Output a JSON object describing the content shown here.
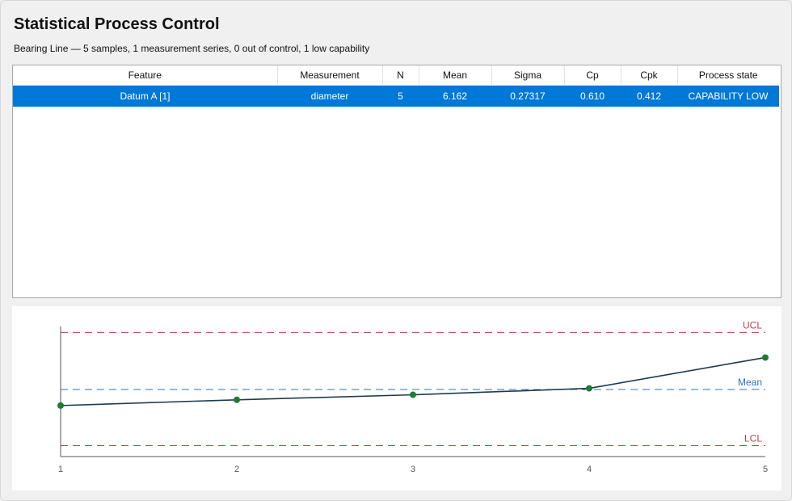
{
  "header": {
    "title": "Statistical Process Control",
    "subtitle": "Bearing Line — 5 samples, 1 measurement series, 0 out of control, 1 low capability"
  },
  "table": {
    "columns": [
      "Feature",
      "Measurement",
      "N",
      "Mean",
      "Sigma",
      "Cp",
      "Cpk",
      "Process state"
    ],
    "rows": [
      {
        "feature": "Datum A [1]",
        "measurement": "diameter",
        "n": "5",
        "mean": "6.162",
        "sigma": "0.27317",
        "cp": "0.610",
        "cpk": "0.412",
        "state": "CAPABILITY LOW",
        "selected": true
      }
    ]
  },
  "colors": {
    "selection": "#0078d7",
    "ucl_lcl": "#c0404a",
    "mean_line": "#2e73b8",
    "series_line": "#1f3a4d",
    "points": "#1e7a34"
  },
  "chart_data": {
    "type": "line",
    "x": [
      1,
      2,
      3,
      4,
      5
    ],
    "xticks": [
      "1",
      "2",
      "3",
      "4",
      "5"
    ],
    "series": [
      {
        "values": [
          6.05,
          6.09,
          6.125,
          6.17,
          6.385
        ]
      }
    ],
    "reference_lines": [
      {
        "label": "UCL",
        "value": 6.56
      },
      {
        "label": "Mean",
        "value": 6.162
      },
      {
        "label": "LCL",
        "value": 5.77
      }
    ],
    "ylim": [
      5.694,
      6.63
    ],
    "grid": false
  }
}
